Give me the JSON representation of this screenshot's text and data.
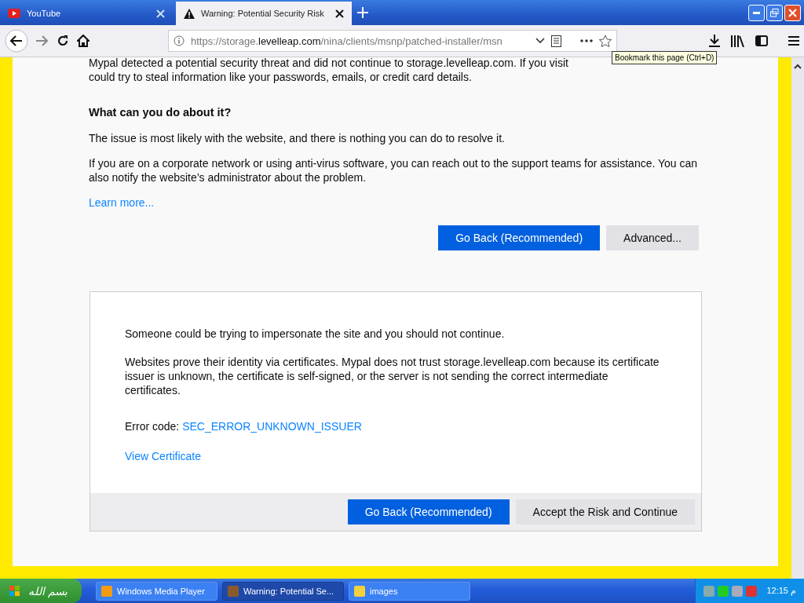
{
  "tabs": [
    {
      "title": "YouTube",
      "selected": false
    },
    {
      "title": "Warning: Potential Security Risk",
      "selected": true
    }
  ],
  "address": {
    "url_prefix": "https://storage.",
    "url_domain": "levelleap.com",
    "url_path": "/nina/clients/msnp/patched-installer/msn"
  },
  "tooltip": "Bookmark this page (Ctrl+D)",
  "page": {
    "intro_lines": [
      "Mypal detected a potential security threat and did not continue to storage.levelleap.com. If you visit",
      "could try to steal information like your passwords, emails, or credit card details."
    ],
    "heading": "What can you do about it?",
    "paragraphs": [
      "The issue is most likely with the website, and there is nothing you can do to resolve it.",
      "If you are on a corporate network or using anti-virus software, you can reach out to the support teams for assistance. You can also notify the website’s administrator about the problem."
    ],
    "learn_more": "Learn more...",
    "buttons": [
      {
        "label": "Go Back (Recommended)",
        "primary": true
      },
      {
        "label": "Advanced...",
        "primary": false
      }
    ]
  },
  "advanced": {
    "paragraphs": [
      "Someone could be trying to impersonate the site and you should not continue.",
      "Websites prove their identity via certificates. Mypal does not trust storage.levelleap.com because its certificate issuer is unknown, the certificate is self-signed, or the server is not sending the correct intermediate certificates."
    ],
    "error_label": "Error code:",
    "error_code": "SEC_ERROR_UNKNOWN_ISSUER",
    "view_certificate": "View Certificate",
    "buttons": [
      {
        "label": "Go Back (Recommended)",
        "primary": true
      },
      {
        "label": "Accept the Risk and Continue",
        "primary": false
      }
    ]
  },
  "taskbar": {
    "start": "بسم الله",
    "items": [
      {
        "label": "Windows Media Player",
        "selected": false
      },
      {
        "label": "Warning: Potential Se...",
        "selected": true
      },
      {
        "label": "images",
        "selected": false
      }
    ],
    "clock": "12:15 م"
  }
}
